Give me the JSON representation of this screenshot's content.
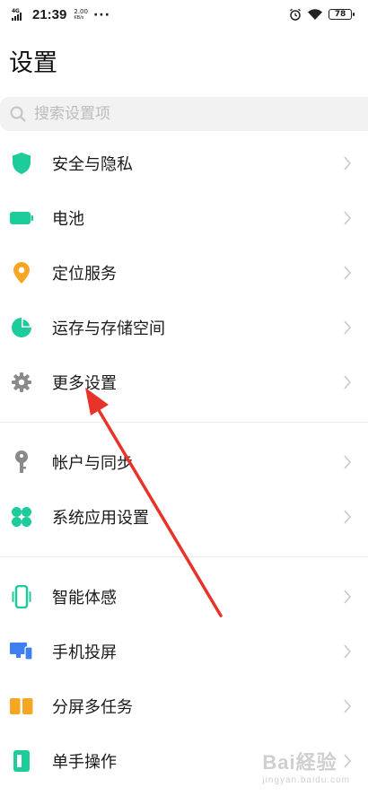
{
  "status_bar": {
    "network": "4G",
    "time": "21:39",
    "speed_value": "2.00",
    "speed_unit": "KB/s",
    "more": "···",
    "battery": "78"
  },
  "page_title": "设置",
  "search": {
    "placeholder": "搜索设置项"
  },
  "items": [
    {
      "label": "安全与隐私",
      "icon": "shield-icon",
      "color": "#1ecb9a"
    },
    {
      "label": "电池",
      "icon": "battery-icon",
      "color": "#1ecb9a"
    },
    {
      "label": "定位服务",
      "icon": "location-pin-icon",
      "color": "#f5a623"
    },
    {
      "label": "运存与存储空间",
      "icon": "pie-chart-icon",
      "color": "#1ecb9a"
    },
    {
      "label": "更多设置",
      "icon": "gear-icon",
      "color": "#8a8a8a"
    },
    {
      "label": "帐户与同步",
      "icon": "key-icon",
      "color": "#8a8a8a"
    },
    {
      "label": "系统应用设置",
      "icon": "clover-icon",
      "color": "#1ecb9a"
    },
    {
      "label": "智能体感",
      "icon": "phone-motion-icon",
      "color": "#1ecb9a"
    },
    {
      "label": "手机投屏",
      "icon": "screen-cast-icon",
      "color": "#3d7ef0"
    },
    {
      "label": "分屏多任务",
      "icon": "split-screen-icon",
      "color": "#f5a623"
    },
    {
      "label": "单手操作",
      "icon": "one-hand-icon",
      "color": "#1ecb9a"
    }
  ],
  "watermark": {
    "text": "Bai経验",
    "sub": "jingyan.baidu.com"
  },
  "annotation_color": "#e8332a"
}
